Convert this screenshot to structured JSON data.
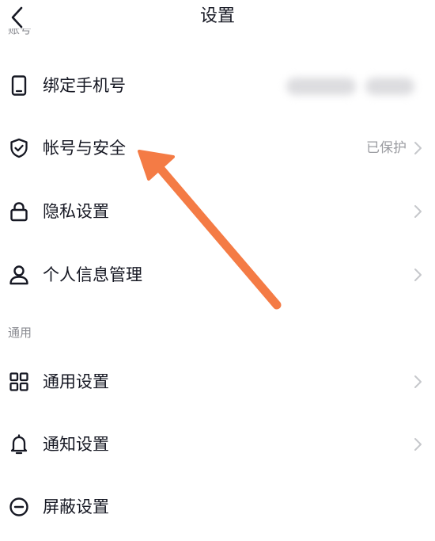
{
  "header": {
    "title": "设置",
    "back_icon": "chevron-left-icon"
  },
  "sections": {
    "account_label": "账号",
    "general_label": "通用"
  },
  "rows": {
    "bind_phone": {
      "label": "绑定手机号",
      "icon": "phone-icon"
    },
    "account_security": {
      "label": "帐号与安全",
      "value": "已保护",
      "icon": "shield-check-icon"
    },
    "privacy": {
      "label": "隐私设置",
      "icon": "lock-icon"
    },
    "personal_info": {
      "label": "个人信息管理",
      "icon": "person-icon"
    },
    "general_settings": {
      "label": "通用设置",
      "icon": "grid-icon"
    },
    "notification": {
      "label": "通知设置",
      "icon": "bell-icon"
    },
    "block": {
      "label": "屏蔽设置",
      "icon": "minus-circle-icon"
    }
  },
  "colors": {
    "text_primary": "#161823",
    "text_secondary": "#9b9ca1",
    "chevron": "#c6c7cb",
    "arrow_annotation": "#f47b45"
  }
}
